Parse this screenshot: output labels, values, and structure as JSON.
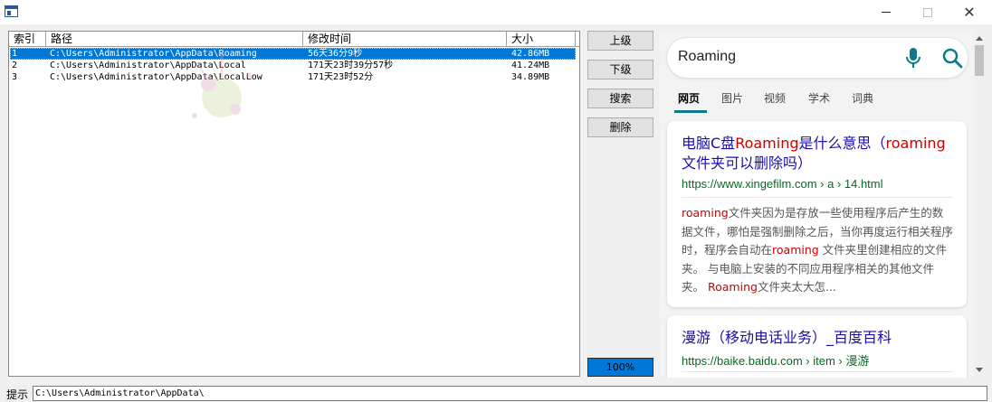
{
  "window": {
    "close_glyph": "✕"
  },
  "listview": {
    "columns": [
      "索引",
      "路径",
      "修改时间",
      "大小"
    ],
    "rows": [
      {
        "index": "1",
        "path": "C:\\Users\\Administrator\\AppData\\Roaming",
        "modified": "56天36分9秒",
        "size": "42.86MB",
        "selected": true
      },
      {
        "index": "2",
        "path": "C:\\Users\\Administrator\\AppData\\Local",
        "modified": "171天23时39分57秒",
        "size": "41.24MB",
        "selected": false
      },
      {
        "index": "3",
        "path": "C:\\Users\\Administrator\\AppData\\LocalLow",
        "modified": "171天23时52分",
        "size": "34.89MB",
        "selected": false
      }
    ]
  },
  "actions": {
    "up_label": "上级",
    "down_label": "下级",
    "search_label": "搜索",
    "delete_label": "删除"
  },
  "progress": {
    "percent": 100,
    "label": "100%"
  },
  "browser": {
    "query": "Roaming",
    "tabs": [
      "网页",
      "图片",
      "视频",
      "学术",
      "词典"
    ],
    "active_tab": 0,
    "results": [
      {
        "title_parts": [
          {
            "text": "电脑C盘",
            "hl": false
          },
          {
            "text": "Roaming",
            "hl": true
          },
          {
            "text": "是什么意思（",
            "hl": false
          },
          {
            "text": "roaming",
            "hl": true
          },
          {
            "text": "文件夹可以删除吗）",
            "hl": false
          }
        ],
        "url": "https://www.xingefilm.com › a › 14.html",
        "snippet_parts": [
          {
            "text": "roaming",
            "hl": true
          },
          {
            "text": "文件夹因为是存放一些使用程序后产生的数据文件，哪怕是强制删除之后，当你再度运行相关程序时，程序会自动在",
            "hl": false
          },
          {
            "text": "roaming",
            "hl": true
          },
          {
            "text": " 文件夹里创建相应的文件夹。 与电脑上安装的不同应用程序相关的其他文件夹。 ",
            "hl": false
          },
          {
            "text": "Roaming",
            "hl": true
          },
          {
            "text": "文件夹太大怎...",
            "hl": false
          }
        ]
      },
      {
        "title_parts": [
          {
            "text": "漫游（移动电话业务）_百度百科",
            "hl": false
          }
        ],
        "url": "https://baike.baidu.com › item › 漫游",
        "snippet_parts": []
      }
    ]
  },
  "statusbar": {
    "label": "提示",
    "value": "C:\\Users\\Administrator\\AppData\\"
  },
  "colors": {
    "selection": "#0078d7",
    "link": "#1a0dab",
    "highlight": "#cc0000",
    "url": "#006d21",
    "tab_underline": "#0c7a8a"
  }
}
